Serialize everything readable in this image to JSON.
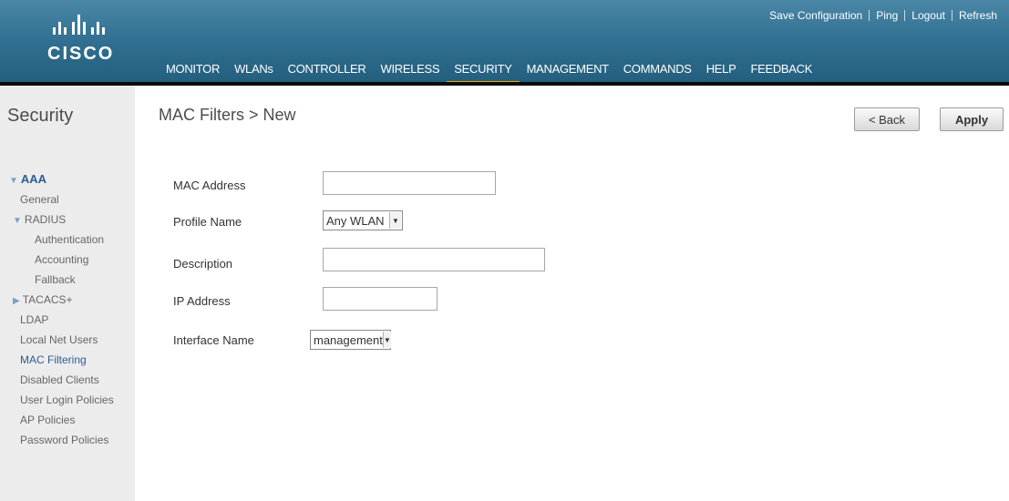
{
  "brand": {
    "name": "CISCO"
  },
  "utility_links": [
    "Save Configuration",
    "Ping",
    "Logout",
    "Refresh"
  ],
  "topnav": {
    "items": [
      "MONITOR",
      "WLANs",
      "CONTROLLER",
      "WIRELESS",
      "SECURITY",
      "MANAGEMENT",
      "COMMANDS",
      "HELP",
      "FEEDBACK"
    ],
    "active": "SECURITY"
  },
  "sidebar": {
    "title": "Security",
    "aaa": "AAA",
    "general": "General",
    "radius": "RADIUS",
    "authentication": "Authentication",
    "accounting": "Accounting",
    "fallback": "Fallback",
    "tacacs": "TACACS+",
    "ldap": "LDAP",
    "local_net_users": "Local Net Users",
    "mac_filtering": "MAC Filtering",
    "disabled_clients": "Disabled Clients",
    "user_login_policies": "User Login Policies",
    "ap_policies": "AP Policies",
    "password_policies": "Password Policies"
  },
  "main": {
    "title": "MAC Filters > New",
    "back_label": "< Back",
    "apply_label": "Apply",
    "form": {
      "mac_address_label": "MAC Address",
      "mac_address_value": "",
      "profile_name_label": "Profile Name",
      "profile_name_value": "Any WLAN",
      "description_label": "Description",
      "description_value": "",
      "ip_address_label": "IP Address",
      "ip_address_value": "",
      "interface_name_label": "Interface Name",
      "interface_name_value": "management"
    }
  },
  "colors": {
    "header": "#2f6e8f",
    "active_tab": "#f3a500",
    "sidebar_bg": "#ececec",
    "link": "#2c5e92"
  }
}
